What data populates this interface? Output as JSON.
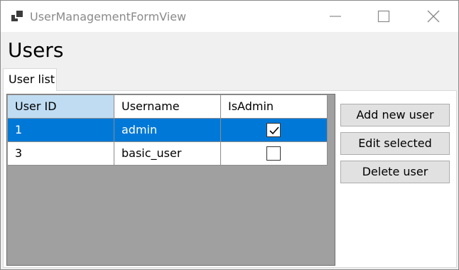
{
  "window": {
    "title": "UserManagementFormView"
  },
  "page": {
    "heading": "Users"
  },
  "tabs": [
    {
      "label": "User list"
    }
  ],
  "grid": {
    "columns": [
      "User ID",
      "Username",
      "IsAdmin"
    ],
    "rows": [
      {
        "user_id": "1",
        "username": "admin",
        "is_admin": true,
        "selected": true
      },
      {
        "user_id": "3",
        "username": "basic_user",
        "is_admin": false,
        "selected": false
      }
    ]
  },
  "actions": {
    "add_label": "Add new user",
    "edit_label": "Edit selected",
    "delete_label": "Delete user"
  },
  "icons": {
    "app": "app-icon",
    "minimize": "minimize-icon",
    "maximize": "maximize-icon",
    "close": "close-icon",
    "check": "checkmark-icon"
  },
  "colors": {
    "selection": "#0078d7",
    "header_highlight": "#bfdcf2",
    "grid_background": "#a0a0a0",
    "button_face": "#e1e1e1"
  }
}
